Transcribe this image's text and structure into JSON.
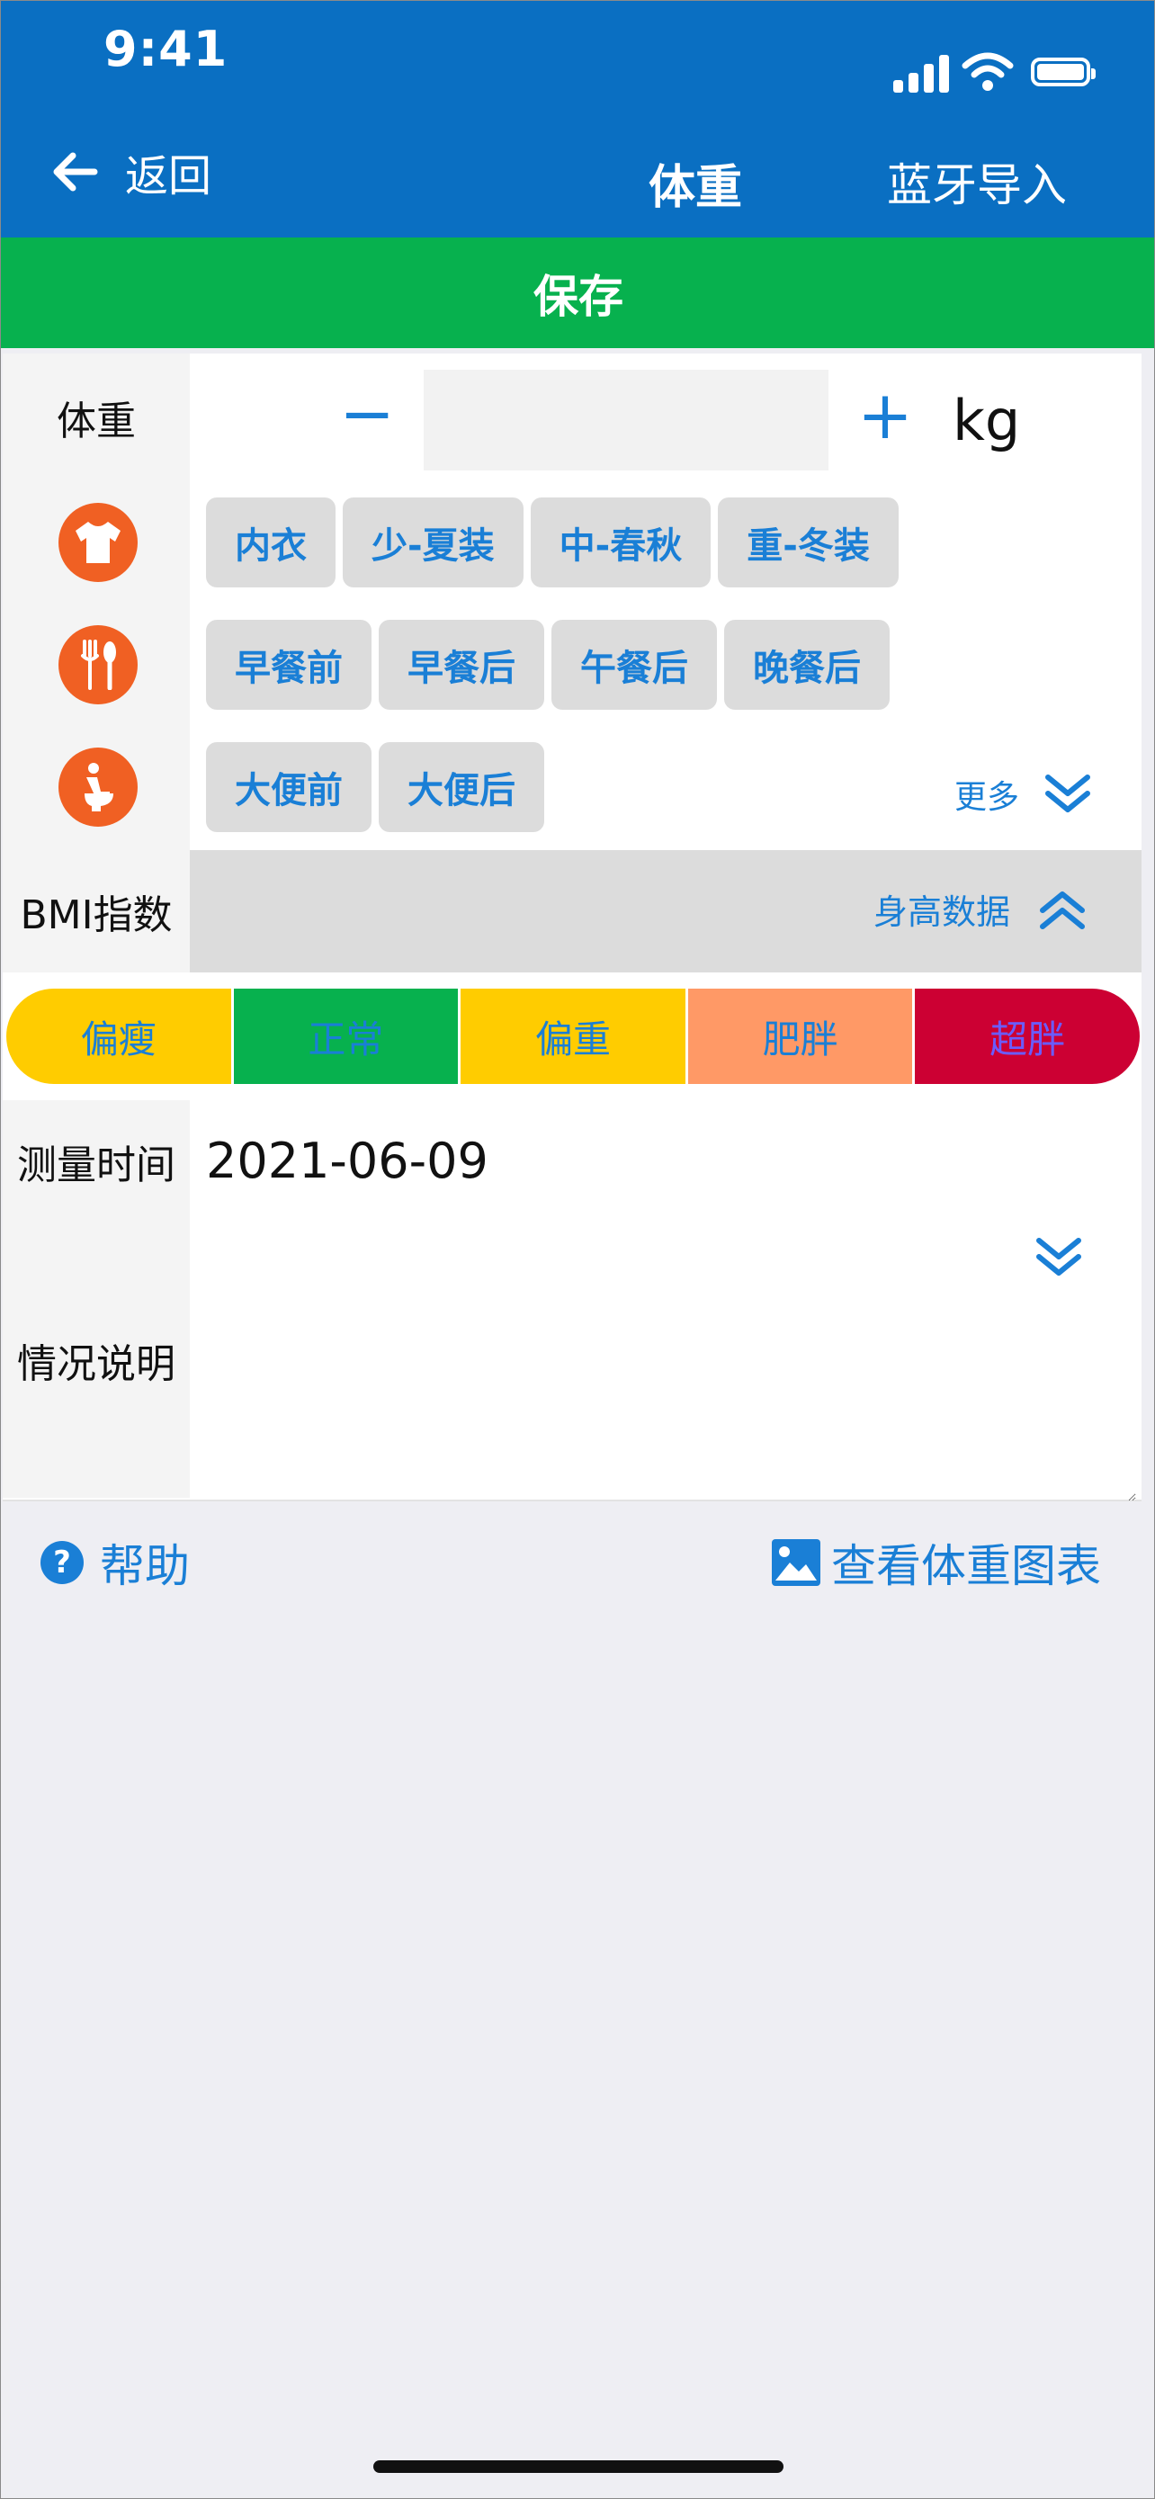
{
  "status_bar": {
    "time": "9:41"
  },
  "nav": {
    "back_label": "返回",
    "title": "体重",
    "right_action": "蓝牙导入"
  },
  "save_label": "保存",
  "weight": {
    "label": "体重",
    "minus": "−",
    "plus": "+",
    "value": "",
    "unit": "kg"
  },
  "clothing": {
    "icon": "tshirt-icon",
    "options": [
      "内衣",
      "少-夏装",
      "中-春秋",
      "重-冬装"
    ]
  },
  "meal": {
    "icon": "fork-spoon-icon",
    "options": [
      "早餐前",
      "早餐后",
      "午餐后",
      "晚餐后"
    ]
  },
  "toilet": {
    "icon": "toilet-icon",
    "options": [
      "大便前",
      "大便后"
    ],
    "more_label": "更多"
  },
  "bmi": {
    "label": "BMI指数",
    "height_data_label": "身高数据"
  },
  "bmi_scale": [
    {
      "label": "偏瘦",
      "bg": "#ffcc00",
      "fg": "#1a7fd6"
    },
    {
      "label": "正常",
      "bg": "#07b14e",
      "fg": "#1a7fd6"
    },
    {
      "label": "偏重",
      "bg": "#ffcc00",
      "fg": "#1a7fd6"
    },
    {
      "label": "肥胖",
      "bg": "#ff9966",
      "fg": "#1a7fd6"
    },
    {
      "label": "超胖",
      "bg": "#cc0033",
      "fg": "#6a5cff"
    }
  ],
  "measure_time": {
    "label": "测量时间",
    "value": "2021-06-09"
  },
  "note": {
    "label": "情况说明",
    "value": ""
  },
  "footer": {
    "help_label": "帮助",
    "chart_label": "查看体重图表"
  },
  "colors": {
    "nav_blue": "#0a6fc2",
    "save_green": "#07b14e",
    "accent_blue": "#1a7fd6",
    "icon_orange": "#f06023"
  }
}
